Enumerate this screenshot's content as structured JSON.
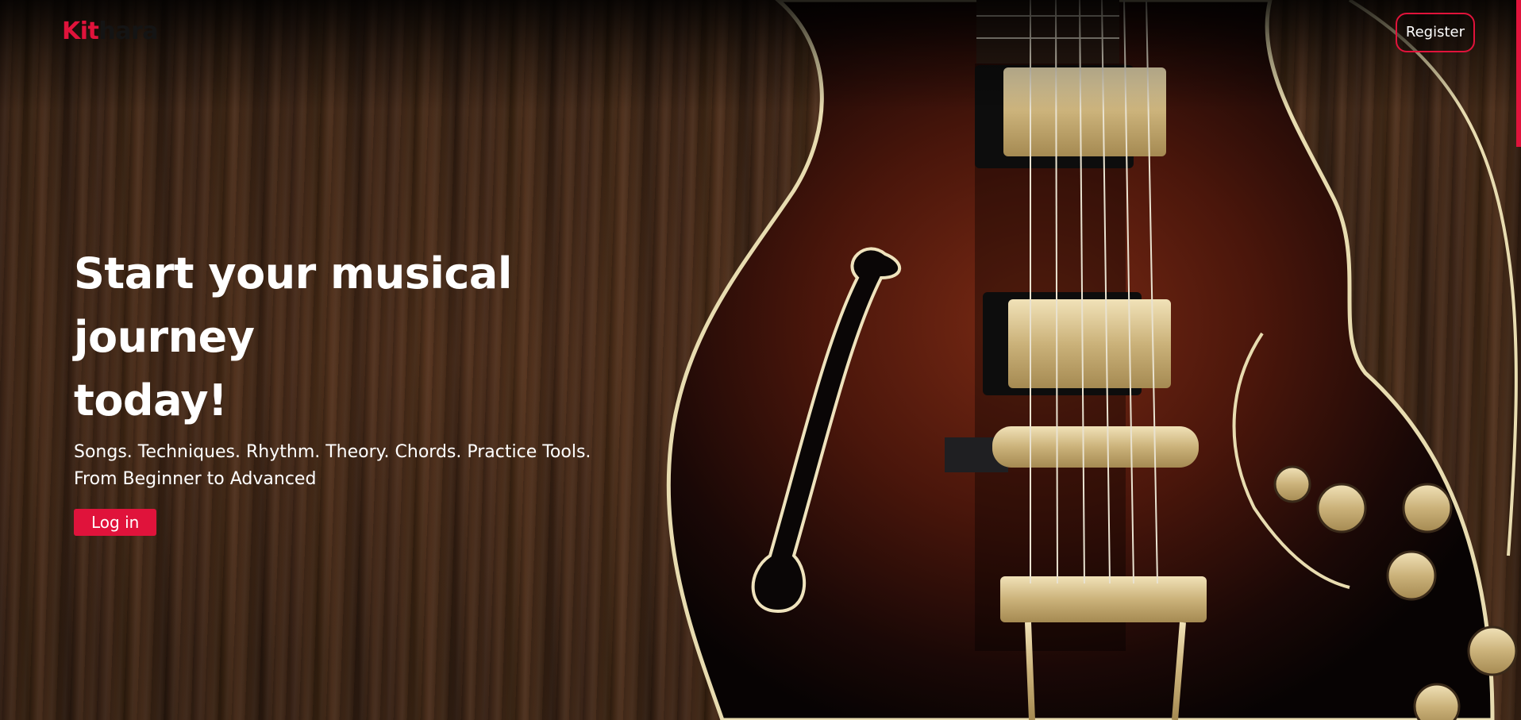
{
  "brand": {
    "logo_part1": "Kit",
    "logo_part2": "hara",
    "accent_color": "#e0133b"
  },
  "nav": {
    "register_label": "Register"
  },
  "hero": {
    "title_line1": "Start your musical journey",
    "title_line2": "today!",
    "subtitle_line1": "Songs. Techniques. Rhythm. Theory. Chords. Practice Tools.",
    "subtitle_line2": "From Beginner to Advanced",
    "login_label": "Log in"
  },
  "background": {
    "image_description_icon": "guitar-photo"
  }
}
